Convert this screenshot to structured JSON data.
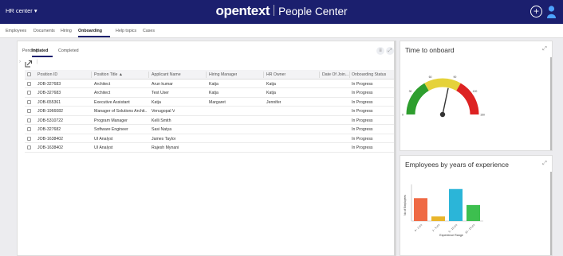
{
  "header": {
    "menu": "HR center",
    "brand_logo": "opentext",
    "brand_app": "People Center",
    "add_icon": "plus-circle-icon",
    "user_icon": "user-icon"
  },
  "nav": {
    "tabs": [
      "Employees",
      "Documents",
      "Hiring",
      "Onboarding",
      "Help topics",
      "Cases"
    ],
    "active": "Onboarding"
  },
  "onboarding": {
    "subtabs": [
      "Pending",
      "Initiated",
      "Completed"
    ],
    "active_subtab": "Initiated",
    "columns": [
      "Position ID",
      "Position Title",
      "Applicant Name",
      "Hiring Manager",
      "HR Owner",
      "Date Of Join...",
      "Onboarding Status"
    ],
    "sort_indicator": "▲",
    "rows": [
      [
        "JOB-327683",
        "Architect",
        "Arun kumar",
        "Katja",
        "Katja",
        "",
        "In Progress"
      ],
      [
        "JOB-327683",
        "Architect",
        "Test User",
        "Katja",
        "Katja",
        "",
        "In Progress"
      ],
      [
        "JOB-655361",
        "Executive Assistant",
        "Katja",
        "Margaret",
        "Jennifer",
        "",
        "In Progress"
      ],
      [
        "JOB-1966082",
        "Manager of Solutions Archit...",
        "Venugopal V",
        "",
        "",
        "",
        "In Progress"
      ],
      [
        "JOB-5310722",
        "Program Manager",
        "Kelli Smith",
        "",
        "",
        "",
        "In Progress"
      ],
      [
        "JOB-327682",
        "Software Engineer",
        "Sasi Natya",
        "",
        "",
        "",
        "In Progress"
      ],
      [
        "JOB-1638402",
        "UI Analyst",
        "James Taylor",
        "",
        "",
        "",
        "In Progress"
      ],
      [
        "JOB-1638402",
        "UI Analyst",
        "Rajesh Mynani",
        "",
        "",
        "",
        "In Progress"
      ]
    ]
  },
  "gauge": {
    "title": "Time to onboard",
    "ticks": [
      "0",
      "30",
      "60",
      "90",
      "120",
      "150"
    ],
    "value": 85,
    "max": 150,
    "colors": {
      "low": "#2e9e2e",
      "mid": "#e5d23a",
      "high": "#dd2222"
    }
  },
  "chart_data": {
    "type": "bar",
    "title": "Employees by years of experience",
    "xlabel": "Experience Range",
    "ylabel": "No of Employees",
    "categories": [
      "0 - 2 yrs",
      "2 - 5 yrs",
      "5 - 10 yrs",
      "10 - 15 yrs"
    ],
    "values": [
      1,
      0.2,
      1.4,
      0.7
    ],
    "colors": [
      "#ef6a45",
      "#e9b52a",
      "#2bb5d8",
      "#3dbf4f"
    ],
    "ylim": [
      0,
      1.6
    ]
  }
}
